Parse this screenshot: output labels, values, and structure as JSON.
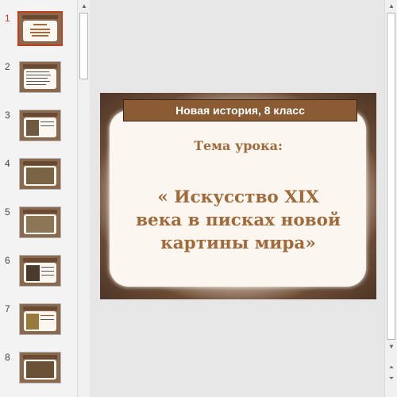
{
  "thumbnails": [
    {
      "number": "1",
      "active": true
    },
    {
      "number": "2",
      "active": false
    },
    {
      "number": "3",
      "active": false
    },
    {
      "number": "4",
      "active": false
    },
    {
      "number": "5",
      "active": false
    },
    {
      "number": "6",
      "active": false
    },
    {
      "number": "7",
      "active": false
    },
    {
      "number": "8",
      "active": false
    }
  ],
  "slide": {
    "title_bar": "Новая история, 8 класс",
    "subtitle": "Тема урока:",
    "main_title": "« Искусство XIX века в писках новой картины мира»"
  },
  "scrollbar": {
    "up_icon": "triangle-up-icon",
    "down_icon": "triangle-down-icon",
    "prev_slide_icon": "double-chevron-up-icon",
    "next_slide_icon": "double-chevron-down-icon"
  },
  "colors": {
    "accent": "#c43e1c",
    "title_bar": "#8a5a32",
    "slide_text": "#a06a3b"
  }
}
